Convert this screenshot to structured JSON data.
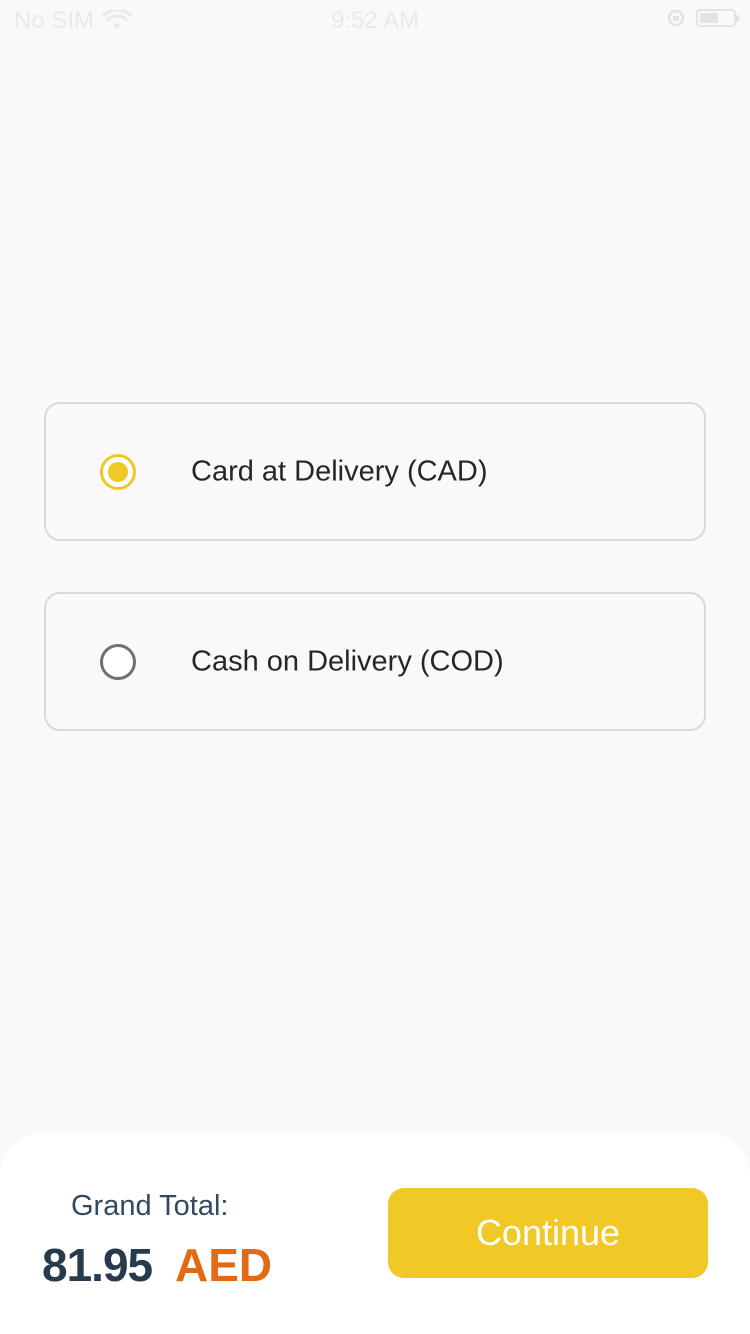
{
  "status_bar": {
    "carrier": "No SIM",
    "time": "9:52 AM",
    "battery_level": 0.55
  },
  "payment_options": [
    {
      "label": "Card at Delivery (CAD)",
      "selected": true
    },
    {
      "label": "Cash on Delivery (COD)",
      "selected": false
    }
  ],
  "footer": {
    "total_label": "Grand Total:",
    "total_amount": "81.95",
    "currency": "AED",
    "continue_label": "Continue"
  },
  "colors": {
    "accent": "#f1c927",
    "currency": "#e36914",
    "amount": "#283a4e"
  }
}
